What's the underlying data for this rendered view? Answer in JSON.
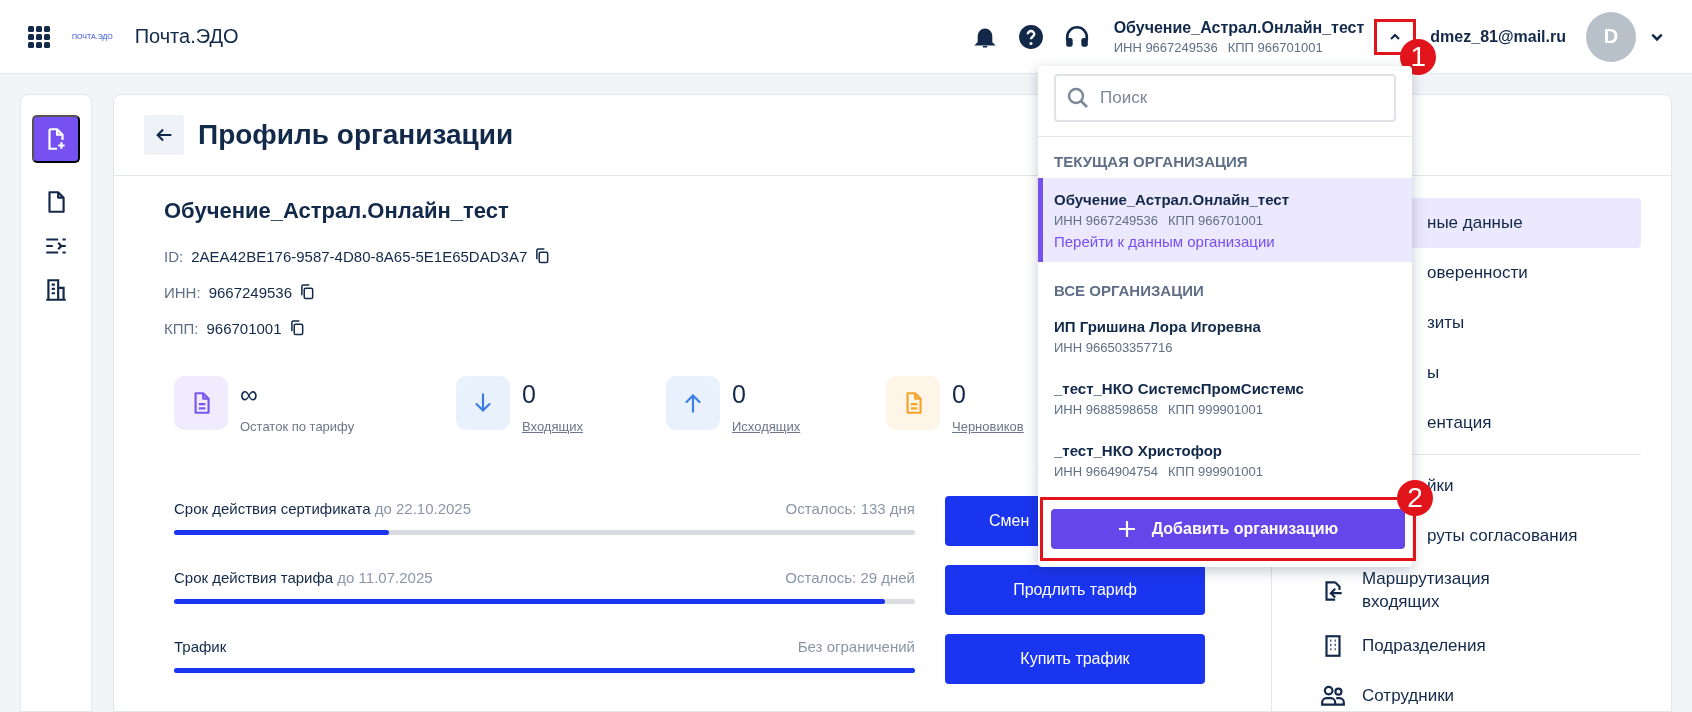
{
  "header": {
    "logo_text": "ПОЧТА.ЭДО",
    "app_name": "Почта.ЭДО",
    "org": {
      "name": "Обучение_Астрал.Онлайн_тест",
      "inn": "ИНН 9667249536",
      "kpp": "КПП 966701001",
      "expanded": true
    },
    "user": {
      "email": "dmez_81@mail.ru",
      "avatar": "D"
    }
  },
  "page": {
    "title": "Профиль организации"
  },
  "organization": {
    "name": "Обучение_Астрал.Онлайн_тест",
    "fields": [
      {
        "label": "ID:",
        "value": "2AEA42BE176-9587-4D80-8A65-5E1E65DAD3A7"
      },
      {
        "label": "ИНН:",
        "value": "9667249536"
      },
      {
        "label": "КПП:",
        "value": "966701001"
      }
    ]
  },
  "stats": [
    {
      "kind": "balance",
      "value": "∞",
      "label": "Остаток по тарифу",
      "color": "#7856f0"
    },
    {
      "kind": "incoming",
      "value": "0",
      "label": "Входящих",
      "color": "#3b7fe6"
    },
    {
      "kind": "outgoing",
      "value": "0",
      "label": "Исходящих",
      "color": "#3b7fe6"
    },
    {
      "kind": "drafts",
      "value": "0",
      "label": "Черновиков",
      "color": "#f5a42a"
    }
  ],
  "limits": [
    {
      "label": "Срок действия сертификата",
      "date": "до 22.10.2025",
      "remaining": "Осталось: 133 дня",
      "level": 0.29,
      "button": "Смен",
      "covered": true
    },
    {
      "label": "Срок действия тарифа",
      "date": "до 11.07.2025",
      "remaining": "Осталось: 29 дней",
      "level": 0.96,
      "button": "Продлить тариф",
      "covered": false
    },
    {
      "label": "Трафик",
      "remaining": "Без ограничений",
      "level": 1,
      "button": "Купить трафик",
      "covered": false
    }
  ],
  "sidebar": {
    "groups": [
      [
        {
          "kind": "covered",
          "label": "ные данные",
          "selected": true
        },
        {
          "kind": "covered",
          "label": "оверенности",
          "selected": false
        },
        {
          "kind": "covered",
          "label": "зиты",
          "selected": false
        },
        {
          "kind": "covered",
          "label": "ы",
          "selected": false
        },
        {
          "kind": "covered",
          "label": "ентация",
          "selected": false
        }
      ],
      [
        {
          "kind": "covered",
          "label": "йки",
          "selected": false
        },
        {
          "kind": "covered",
          "label": "руты согласования",
          "selected": false
        },
        {
          "kind": "routing",
          "label": "Маршрутизация входящих",
          "selected": false
        },
        {
          "kind": "departments",
          "label": "Подразделения",
          "selected": false
        },
        {
          "kind": "employees",
          "label": "Сотрудники",
          "selected": false
        }
      ]
    ]
  },
  "dropdown": {
    "search": {
      "placeholder": "Поиск"
    },
    "current_heading": "ТЕКУЩАЯ ОРГАНИЗАЦИЯ",
    "current": {
      "name": "Обучение_Астрал.Онлайн_тест",
      "inn": "ИНН 9667249536",
      "kpp": "КПП 966701001",
      "link": "Перейти к данным организации"
    },
    "all_heading": "ВСЕ ОРГАНИЗАЦИИ",
    "organizations": [
      {
        "name": "ИП Гришина Лора Игоревна",
        "inn": "ИНН 966503357716"
      },
      {
        "name": "_тест_НКО СистемсПромСистемс",
        "inn": "ИНН 9688598658",
        "kpp": "КПП 999901001"
      },
      {
        "name": "_тест_НКО Христофор",
        "inn": "ИНН 9664904754",
        "kpp": "КПП 999901001"
      }
    ],
    "add_button": "Добавить организацию"
  },
  "annotations": [
    {
      "number": "1"
    },
    {
      "number": "2"
    }
  ]
}
